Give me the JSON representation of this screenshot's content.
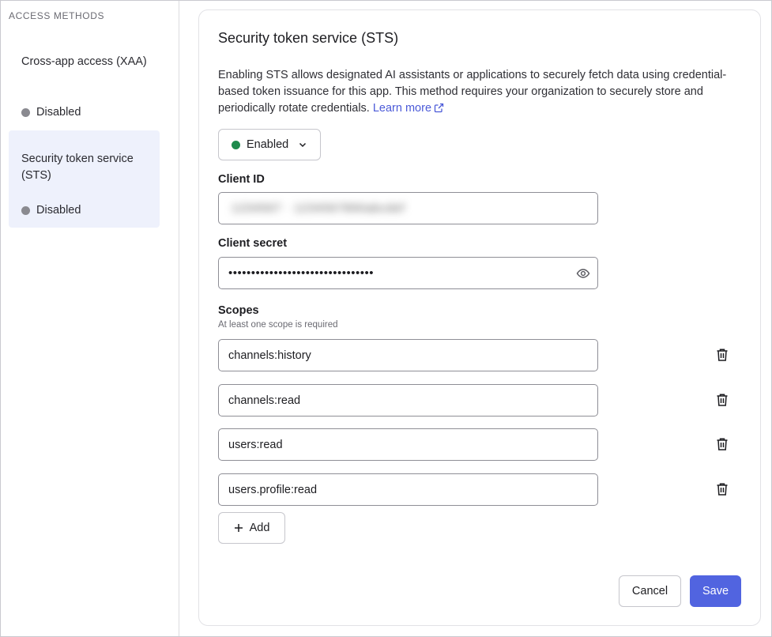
{
  "sidebar": {
    "heading": "ACCESS METHODS",
    "items": [
      {
        "title": "Cross-app access (XAA)",
        "status": "Disabled",
        "status_color": "#8a8a90"
      },
      {
        "title": "Security token service (STS)",
        "status": "Disabled",
        "status_color": "#8a8a90"
      }
    ]
  },
  "card": {
    "title": "Security token service (STS)",
    "description": "Enabling STS allows designated AI assistants or applications to securely fetch data using credential-based token issuance for this app. This method requires your organization to securely store and periodically rotate credentials.",
    "learn_more": "Learn more",
    "status_dropdown": {
      "value": "Enabled",
      "dot_color": "#1e8a4c"
    },
    "client_id": {
      "label": "Client ID",
      "value": "1234567 · 1234567890abcdef"
    },
    "client_secret": {
      "label": "Client secret",
      "value": "••••••••••••••••••••••••••••••••"
    },
    "scopes": {
      "label": "Scopes",
      "hint": "At least one scope is required",
      "items": [
        "channels:history",
        "channels:read",
        "users:read",
        "users.profile:read"
      ]
    },
    "add_label": "Add",
    "cancel_label": "Cancel",
    "save_label": "Save"
  },
  "colors": {
    "accent": "#5164e0",
    "link": "#4b5ad8",
    "selected_bg": "#eef1fc"
  }
}
